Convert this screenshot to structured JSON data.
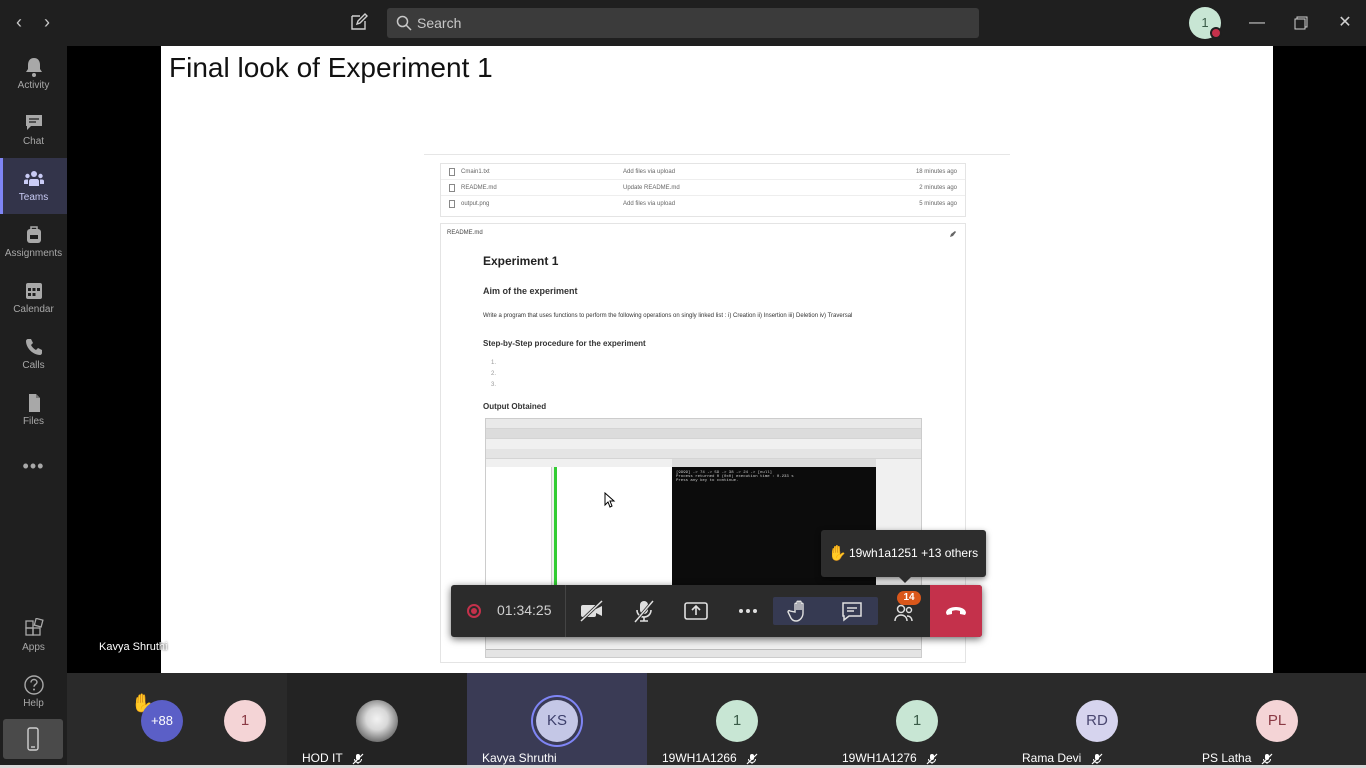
{
  "search": {
    "placeholder": "Search"
  },
  "me": {
    "initial": "1"
  },
  "rail": {
    "items": [
      {
        "label": "Activity"
      },
      {
        "label": "Chat"
      },
      {
        "label": "Teams"
      },
      {
        "label": "Assignments"
      },
      {
        "label": "Calendar"
      },
      {
        "label": "Calls"
      },
      {
        "label": "Files"
      }
    ],
    "more": "•••",
    "apps": "Apps",
    "help": "Help"
  },
  "slide": {
    "title": "Final look of Experiment 1",
    "files": [
      {
        "name": "Cmain1.txt",
        "commit": "Add files via upload",
        "time": "18 minutes ago"
      },
      {
        "name": "README.md",
        "commit": "Update README.md",
        "time": "2 minutes ago"
      },
      {
        "name": "output.png",
        "commit": "Add files via upload",
        "time": "5 minutes ago"
      }
    ],
    "readme_label": "README.md",
    "h1": "Experiment 1",
    "aim_heading": "Aim of the experiment",
    "aim_text": "Write a program that uses functions to perform the following operations on singly linked list : i) Creation ii) Insertion iii) Deletion iv) Traversal",
    "steps_heading": "Step-by-Step procedure for the experiment",
    "steps": [
      "1.",
      "2.",
      "3."
    ],
    "output_heading": "Output Obtained",
    "console_lines": [
      "[9999] -> 74 -> 59 -> 38 -> 24 -> [null]",
      "Process returned 0 (0x0)   execution time : 0.233 s",
      "Press any key to continue."
    ]
  },
  "raise_hand": {
    "text": "19wh1a1251 +13 others",
    "icon": "hand-icon"
  },
  "controls": {
    "timer": "01:34:25",
    "participants_badge": "14"
  },
  "stage_speaker": "Kavya Shruthi",
  "participants": [
    {
      "initials": "+88",
      "name": "",
      "raised": true,
      "bg": "#5b5fc7",
      "fg": "#ffffff"
    },
    {
      "initials": "1",
      "name": "",
      "bg": "#f4d4d6",
      "fg": "#8a3a45"
    },
    {
      "initials": "",
      "name": "HOD IT",
      "photo": true
    },
    {
      "initials": "KS",
      "name": "Kavya Shruthi",
      "bg": "#c4c7e6",
      "fg": "#3c3f6b",
      "active": true
    },
    {
      "initials": "1",
      "name": "19WH1A1266",
      "bg": "#c8e6d4",
      "fg": "#3a5b48"
    },
    {
      "initials": "1",
      "name": "19WH1A1276",
      "bg": "#c8e6d4",
      "fg": "#3a5b48"
    },
    {
      "initials": "RD",
      "name": "Rama Devi",
      "bg": "#d6d4ee",
      "fg": "#4a4770"
    },
    {
      "initials": "PL",
      "name": "PS Latha",
      "bg": "#f4d4d6",
      "fg": "#8a3a45"
    }
  ]
}
